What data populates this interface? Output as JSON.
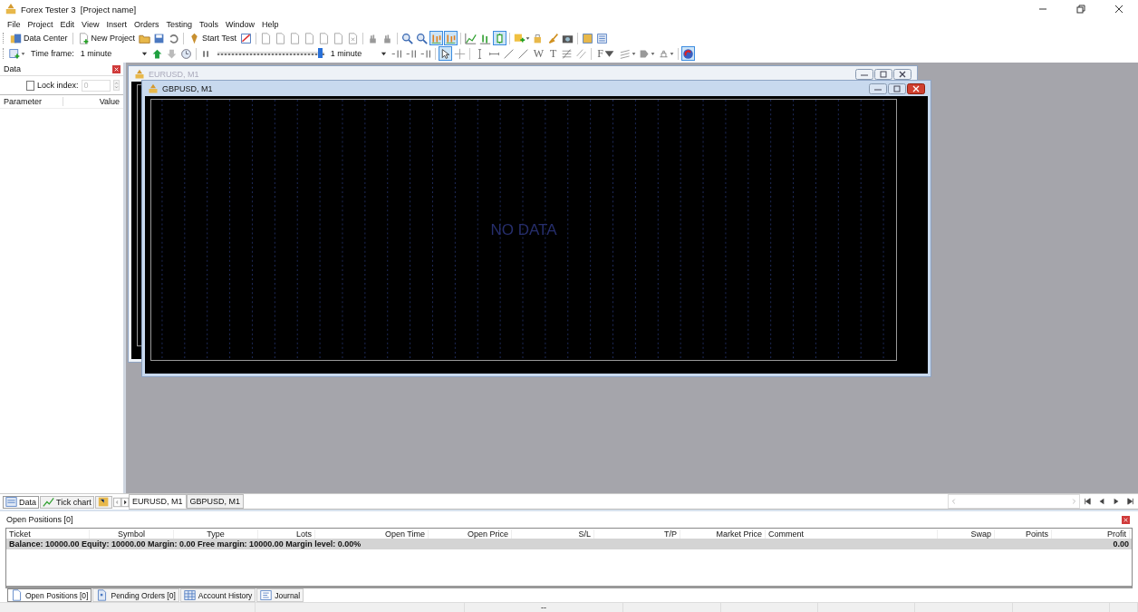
{
  "window": {
    "title": "Forex Tester 3  [Project name]"
  },
  "menu": [
    "File",
    "Project",
    "Edit",
    "View",
    "Insert",
    "Orders",
    "Testing",
    "Tools",
    "Window",
    "Help"
  ],
  "toolbar1": {
    "buttons": [
      {
        "label": "Data Center"
      },
      {
        "label": "New Project"
      },
      {
        "label": "Start Test"
      }
    ],
    "icons": [
      {
        "pressed": false
      },
      {
        "pressed": false
      },
      {
        "pressed": false
      },
      {
        "pressed": false
      },
      {
        "pressed": false
      },
      {
        "pressed": false
      },
      {
        "pressed": false
      },
      {
        "pressed": false
      },
      {
        "pressed": false
      },
      {
        "pressed": false
      },
      {
        "pressed": false
      },
      {
        "pressed": false
      },
      {
        "pressed": false
      },
      {
        "pressed": false
      },
      {
        "pressed": false
      },
      {
        "pressed": true
      },
      {
        "pressed": true
      },
      {
        "pressed": false
      },
      {
        "pressed": false
      },
      {
        "pressed": true
      },
      {
        "pressed": false
      },
      {
        "pressed": false
      },
      {
        "pressed": false
      },
      {
        "pressed": false
      },
      {
        "pressed": false
      },
      {
        "pressed": false
      }
    ]
  },
  "toolbar2": {
    "label": "Time frame:",
    "selects": [
      "1 minute",
      "1 minute"
    ],
    "speed_slider": {
      "level": 0.97
    },
    "icons": [
      {
        "pressed": false
      },
      {
        "pressed": false
      },
      {
        "pressed": false
      },
      {
        "pressed": false
      },
      {
        "pressed": false
      },
      {
        "pressed": false
      },
      {
        "pressed": false
      },
      {
        "pressed": false
      },
      {
        "pressed": true
      },
      {
        "pressed": false
      },
      {
        "pressed": false
      },
      {
        "pressed": false
      },
      {
        "pressed": false
      },
      {
        "pressed": false
      },
      {
        "pressed": false,
        "glyph": "W"
      },
      {
        "pressed": false,
        "glyph": "T"
      },
      {
        "pressed": false
      },
      {
        "pressed": false
      },
      {
        "pressed": false,
        "glyph": "F"
      },
      {
        "pressed": false
      },
      {
        "pressed": false
      },
      {
        "pressed": false
      },
      {
        "pressed": true
      }
    ]
  },
  "data_panel": {
    "title": "Data",
    "lock_index": {
      "label": "Lock index:",
      "checked": false,
      "value": "0"
    },
    "columns": [
      "Parameter",
      "Value"
    ],
    "tabs": [
      {
        "label": "Data",
        "selected": true
      },
      {
        "label": "Tick chart",
        "selected": false
      },
      {
        "selected": false
      }
    ]
  },
  "chart_windows": [
    {
      "title": "EURUSD, M1",
      "active": false
    },
    {
      "title": "GBPUSD, M1",
      "active": true,
      "message": "NO DATA"
    }
  ],
  "window_tabs": [
    {
      "label": "EURUSD, M1",
      "selected": true
    },
    {
      "label": "GBPUSD, M1",
      "selected": false
    }
  ],
  "positions_panel": {
    "title": "Open Positions [0]",
    "columns": [
      "Ticket",
      "Symbol",
      "Type",
      "Lots",
      "Open Time",
      "Open Price",
      "S/L",
      "T/P",
      "Market Price",
      "Comment",
      "Swap",
      "Points",
      "Profit"
    ],
    "summary": "Balance: 10000.00 Equity: 10000.00 Margin: 0.00 Free margin: 10000.00 Margin level: 0.00%",
    "summary_profit": "0.00",
    "tabs": [
      {
        "label": "Open Positions [0]",
        "selected": true
      },
      {
        "label": "Pending Orders [0]",
        "selected": false
      },
      {
        "label": "Account History",
        "selected": false
      },
      {
        "label": "Journal",
        "selected": false
      }
    ]
  },
  "status_bar": {
    "text": "--"
  }
}
